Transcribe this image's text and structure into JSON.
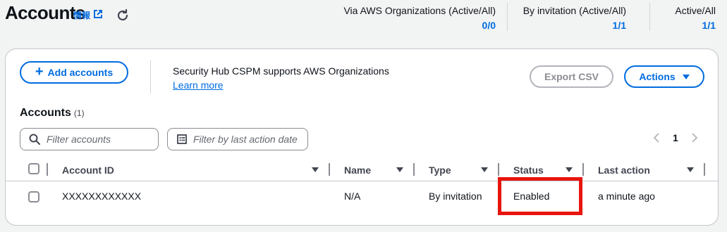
{
  "header": {
    "title": "Accounts",
    "info_label": "情報",
    "stats": [
      {
        "label": "Via AWS Organizations (Active/All)",
        "value": "0/0"
      },
      {
        "label": "By invitation (Active/All)",
        "value": "1/1"
      },
      {
        "label": "Active/All",
        "value": "1/1"
      }
    ]
  },
  "toolbar": {
    "add_label": "Add accounts",
    "org_message": "Security Hub CSPM supports AWS Organizations",
    "learn_more": "Learn more",
    "export_label": "Export CSV",
    "actions_label": "Actions"
  },
  "section": {
    "title": "Accounts",
    "count": "(1)"
  },
  "filters": {
    "search_placeholder": "Filter accounts",
    "date_placeholder": "Filter by last action date"
  },
  "pagination": {
    "current_page": "1"
  },
  "table": {
    "columns": [
      "Account ID",
      "Name",
      "Type",
      "Status",
      "Last action"
    ],
    "rows": [
      {
        "account_id": "XXXXXXXXXXXX",
        "name": "N/A",
        "type": "By invitation",
        "status": "Enabled",
        "last_action": "a minute ago"
      }
    ]
  },
  "colors": {
    "accent": "#006ce0",
    "highlight": "#e8140d"
  }
}
